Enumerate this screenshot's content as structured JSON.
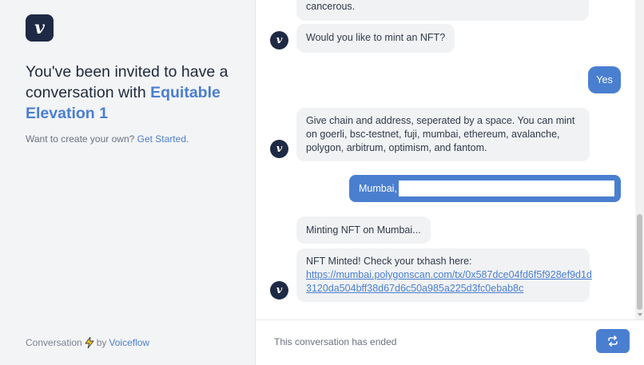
{
  "sidebar": {
    "logo_letter": "v",
    "invite_prefix": "You've been invited to have a conversation with ",
    "assistant_name": "Equitable Elevation 1",
    "create_prefix": "Want to create your own? ",
    "get_started": "Get Started",
    "create_suffix": ".",
    "footer_label": "Conversation",
    "footer_by": "by",
    "footer_brand": "Voiceflow",
    "icons": {
      "logo": "voiceflow-logo",
      "bolt": "bolt-icon"
    }
  },
  "chat": {
    "messages": [
      {
        "role": "bot",
        "text": "cancerous."
      },
      {
        "role": "bot",
        "text": "Would you like to mint an NFT?"
      },
      {
        "role": "user",
        "text": "Yes"
      },
      {
        "role": "bot",
        "text": "Give chain and address, seperated by a space. You can mint on goerli, bsc-testnet, fuji, mumbai, ethereum, avalanche, polygon, arbitrum, optimism, and fantom."
      },
      {
        "role": "user_input",
        "text": "Mumbai,"
      },
      {
        "role": "bot",
        "text": "Minting NFT on Mumbai..."
      },
      {
        "role": "bot",
        "text": "NFT Minted! Check your txhash here:",
        "link": "https://mumbai.polygonscan.com/tx/0x587dce04fd6f5f928ef9d1d3120da504bff38d67d6c50a985a225d3fc0ebab8c",
        "link_line1": "https://mumbai.polygonscan.com/tx/0x587dce04fd6f5f928ef9d1d",
        "link_line2": "3120da504bff38d67d6c50a985a225d3fc0ebab8c"
      }
    ],
    "avatar_letter": "v"
  },
  "footer": {
    "ended_text": "This conversation has ended",
    "restart_icon": "refresh-icon"
  },
  "colors": {
    "accent": "#4a7fd0",
    "navy": "#1e2a44",
    "sidebar_bg": "#f3f4f6",
    "bot_bubble": "#f1f2f4"
  }
}
